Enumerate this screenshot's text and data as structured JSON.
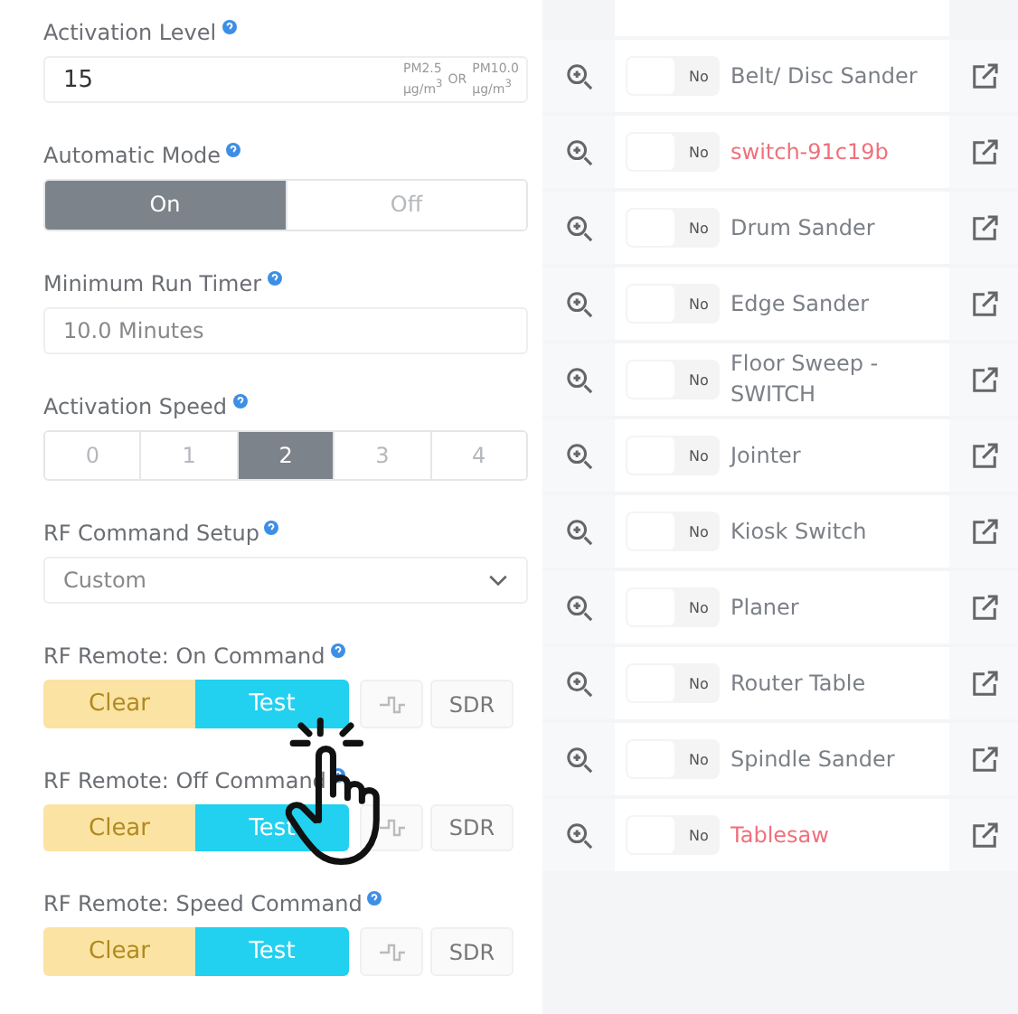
{
  "settings": {
    "activation_level": {
      "label": "Activation Level",
      "value": "15",
      "unit_a": "PM2.5",
      "unit_a_sub": "µg/m$^{3}$",
      "or": "OR",
      "unit_b": "PM10.0",
      "unit_b_sub": "µg/m$^{3}$"
    },
    "automatic_mode": {
      "label": "Automatic Mode",
      "options": [
        {
          "label": "On",
          "selected": true
        },
        {
          "label": "Off",
          "selected": false
        }
      ]
    },
    "minimum_run_timer": {
      "label": "Minimum Run Timer",
      "placeholder": "10.0 Minutes"
    },
    "activation_speed": {
      "label": "Activation Speed",
      "options": [
        {
          "label": "0",
          "selected": false
        },
        {
          "label": "1",
          "selected": false
        },
        {
          "label": "2",
          "selected": true
        },
        {
          "label": "3",
          "selected": false
        },
        {
          "label": "4",
          "selected": false
        }
      ]
    },
    "rf_command_setup": {
      "label": "RF Command Setup",
      "value": "Custom"
    },
    "rf_commands": [
      {
        "label": "RF Remote: On Command",
        "clear": "Clear",
        "test": "Test",
        "sdr": "SDR"
      },
      {
        "label": "RF Remote: Off Command",
        "clear": "Clear",
        "test": "Test",
        "sdr": "SDR"
      },
      {
        "label": "RF Remote: Speed Command",
        "clear": "Clear",
        "test": "Test",
        "sdr": "SDR"
      }
    ]
  },
  "switches": [
    {
      "name": "Belt/ Disc Sander",
      "toggle": "No",
      "on": false,
      "color": "#7b7f86"
    },
    {
      "name": "switch-91c19b",
      "toggle": "No",
      "on": false,
      "color": "#f0707c"
    },
    {
      "name": "Drum Sander",
      "toggle": "No",
      "on": false,
      "color": "#7b7f86"
    },
    {
      "name": "Edge Sander",
      "toggle": "No",
      "on": false,
      "color": "#7b7f86"
    },
    {
      "name": "Floor Sweep - SWITCH",
      "toggle": "No",
      "on": false,
      "color": "#7b7f86"
    },
    {
      "name": "Jointer",
      "toggle": "No",
      "on": false,
      "color": "#7b7f86"
    },
    {
      "name": "Kiosk Switch",
      "toggle": "No",
      "on": false,
      "color": "#7b7f86"
    },
    {
      "name": "Planer",
      "toggle": "No",
      "on": false,
      "color": "#7b7f86"
    },
    {
      "name": "Router Table",
      "toggle": "No",
      "on": false,
      "color": "#7b7f86"
    },
    {
      "name": "Spindle Sander",
      "toggle": "No",
      "on": false,
      "color": "#7b7f86"
    },
    {
      "name": "Tablesaw",
      "toggle": "No",
      "on": false,
      "color": "#f0707c"
    }
  ]
}
